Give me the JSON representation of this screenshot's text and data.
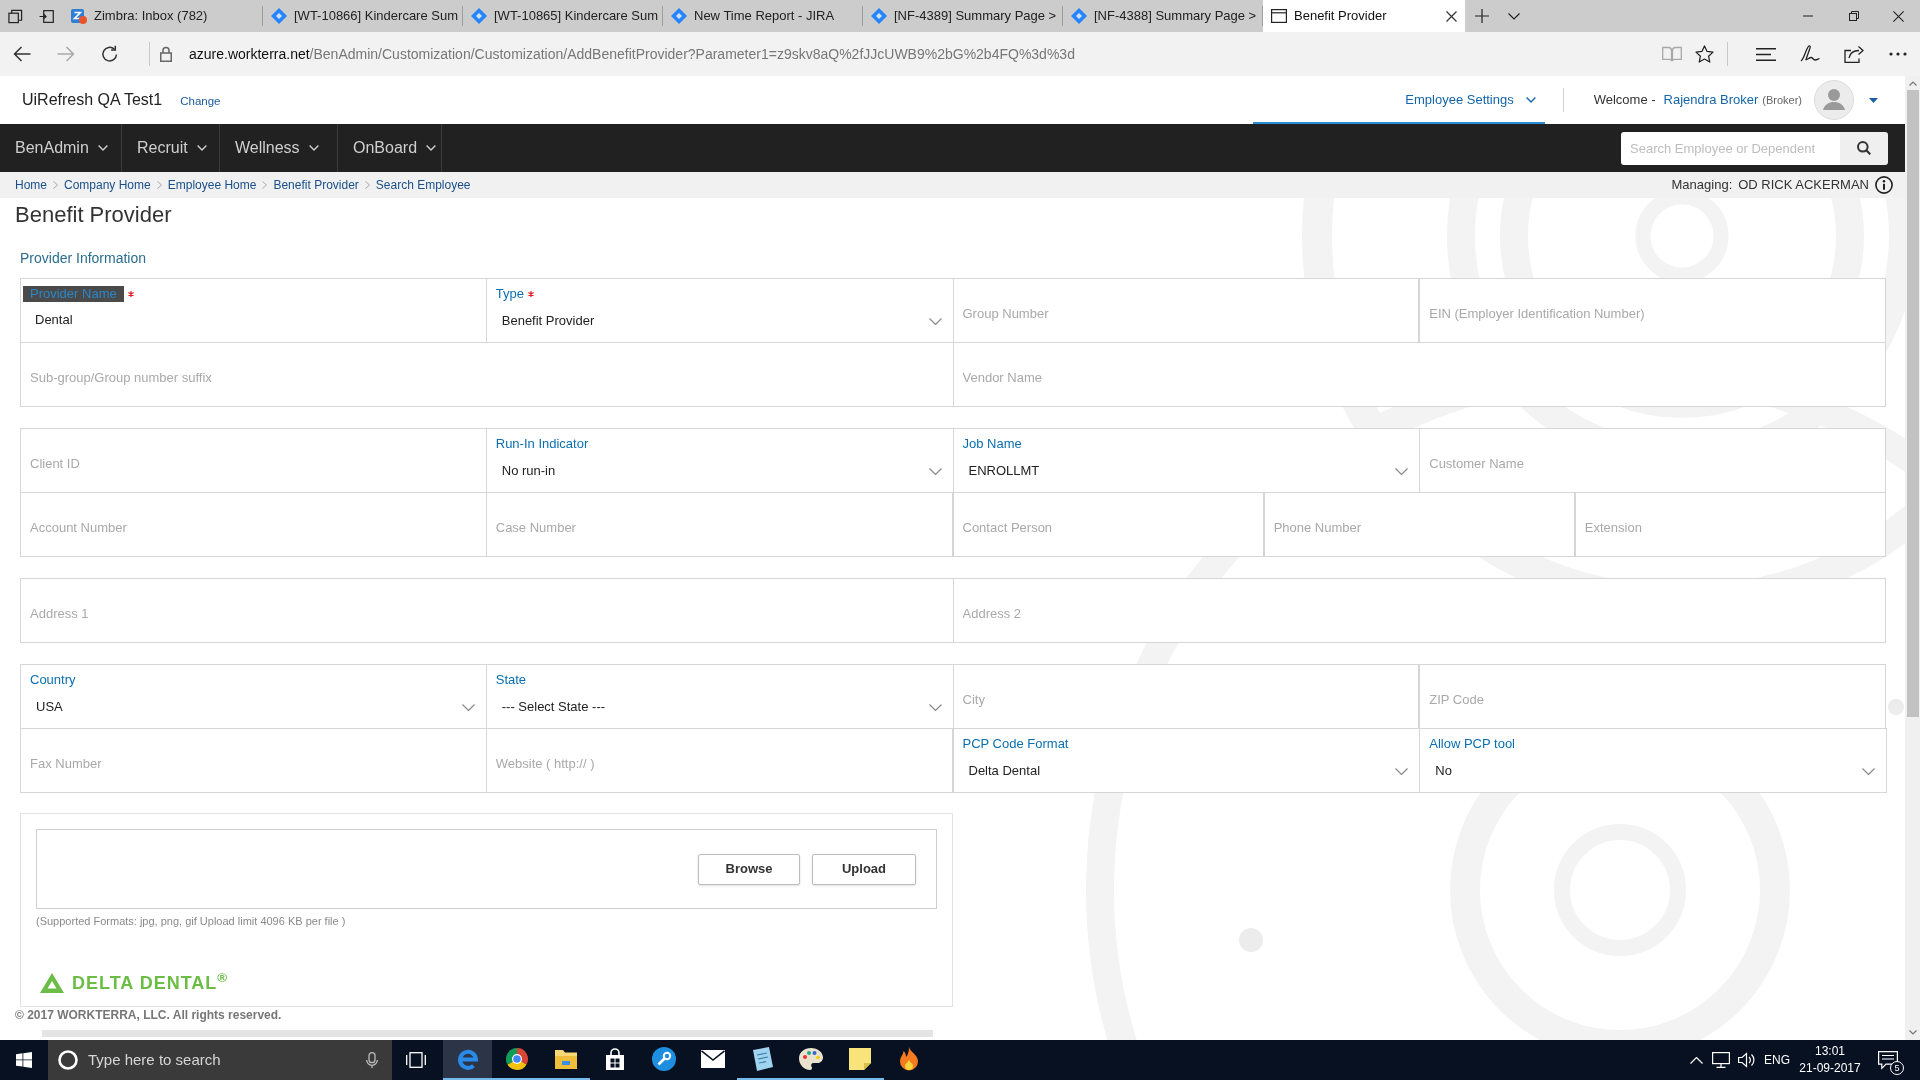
{
  "browser": {
    "tabs": [
      {
        "kind": "zimbra",
        "title": "Zimbra: Inbox (782)",
        "selected": false
      },
      {
        "kind": "jira",
        "title": "[WT-10866] Kindercare Sum",
        "selected": false
      },
      {
        "kind": "jira",
        "title": "[WT-10865] Kindercare Sum",
        "selected": false
      },
      {
        "kind": "jira",
        "title": "New Time Report - JIRA",
        "selected": false
      },
      {
        "kind": "jira",
        "title": "[NF-4389] Summary Page >",
        "selected": false
      },
      {
        "kind": "jira",
        "title": "[NF-4388] Summary Page >",
        "selected": false
      },
      {
        "kind": "page",
        "title": "Benefit Provider",
        "selected": true
      }
    ],
    "address": {
      "host": "azure.workterra.net",
      "path": "/BenAdmin/Customization/Customization/AddBenefitProvider?Parameter1=z9skv8aQ%2fJJcUWB9%2bG%2b4FQ%3d%3d"
    }
  },
  "header": {
    "company": "UiRefresh QA Test1",
    "change": "Change",
    "settings": "Employee Settings",
    "welcome": "Welcome -",
    "user": "Rajendra Broker",
    "role": "(Broker)"
  },
  "nav": {
    "menus": [
      {
        "label": "BenAdmin"
      },
      {
        "label": "Recruit"
      },
      {
        "label": "Wellness"
      },
      {
        "label": "OnBoard"
      }
    ],
    "search": {
      "placeholder": "Search Employee or Dependent"
    }
  },
  "breadcrumbs": [
    {
      "label": "Home"
    },
    {
      "label": "Company Home"
    },
    {
      "label": "Employee Home"
    },
    {
      "label": "Benefit Provider"
    },
    {
      "label": "Search Employee"
    }
  ],
  "managing": {
    "label": "Managing:",
    "name": "OD RICK ACKERMAN"
  },
  "title": "Benefit Provider",
  "section": "Provider Information",
  "groups": [
    {
      "rows": [
        {
          "fields": [
            {
              "kind": "text",
              "label": "Provider Name",
              "required": true,
              "highlighted": true,
              "value": "Dental"
            },
            {
              "kind": "select",
              "label": "Type",
              "required": true,
              "highlighted": false,
              "value": "Benefit Provider"
            },
            {
              "kind": "text",
              "placeholder": "Group Number",
              "required": false,
              "highlighted": false
            },
            {
              "kind": "text",
              "placeholder": "EIN (Employer Identification Number)",
              "required": false,
              "highlighted": false
            }
          ]
        },
        {
          "fields": [
            {
              "kind": "text",
              "placeholder": "Sub-group/Group number suffix",
              "required": false,
              "highlighted": false
            },
            {
              "kind": "text",
              "placeholder": "Vendor Name",
              "required": false,
              "highlighted": false
            }
          ]
        }
      ]
    },
    {
      "rows": [
        {
          "fields": [
            {
              "kind": "text",
              "placeholder": "Client ID",
              "required": false,
              "highlighted": false
            },
            {
              "kind": "select",
              "label": "Run-In Indicator",
              "required": false,
              "highlighted": false,
              "value": "No run-in"
            },
            {
              "kind": "select",
              "label": "Job Name",
              "required": false,
              "highlighted": false,
              "value": "ENROLLMT"
            },
            {
              "kind": "text",
              "placeholder": "Customer Name",
              "required": false,
              "highlighted": false
            }
          ]
        },
        {
          "fields": [
            {
              "kind": "text",
              "placeholder": "Account Number",
              "required": false,
              "highlighted": false
            },
            {
              "kind": "text",
              "placeholder": "Case Number",
              "required": false,
              "highlighted": false
            },
            {
              "kind": "text",
              "placeholder": "Contact Person",
              "required": false,
              "highlighted": false
            },
            {
              "kind": "text",
              "placeholder": "Phone Number",
              "required": false,
              "highlighted": false
            },
            {
              "kind": "text",
              "placeholder": "Extension",
              "required": false,
              "highlighted": false
            }
          ]
        }
      ]
    },
    {
      "rows": [
        {
          "fields": [
            {
              "kind": "text",
              "placeholder": "Address 1",
              "required": false,
              "highlighted": false
            },
            {
              "kind": "text",
              "placeholder": "Address 2",
              "required": false,
              "highlighted": false
            }
          ]
        }
      ]
    },
    {
      "rows": [
        {
          "fields": [
            {
              "kind": "select",
              "label": "Country",
              "required": false,
              "highlighted": false,
              "value": "USA"
            },
            {
              "kind": "select",
              "label": "State",
              "required": false,
              "highlighted": false,
              "value": "--- Select State ---"
            },
            {
              "kind": "text",
              "placeholder": "City",
              "required": false,
              "highlighted": false
            },
            {
              "kind": "text",
              "placeholder": "ZIP Code",
              "required": false,
              "highlighted": false
            }
          ]
        },
        {
          "fields": [
            {
              "kind": "text",
              "placeholder": "Fax Number",
              "required": false,
              "highlighted": false
            },
            {
              "kind": "text",
              "placeholder": "Website ( http:// )",
              "required": false,
              "highlighted": false
            },
            {
              "kind": "select",
              "label": "PCP Code Format",
              "required": false,
              "highlighted": false,
              "value": "Delta Dental"
            },
            {
              "kind": "select",
              "label": "Allow PCP tool",
              "required": false,
              "highlighted": false,
              "value": "No"
            }
          ]
        }
      ]
    }
  ],
  "upload": {
    "browse": "Browse",
    "upload": "Upload",
    "note": "(Supported Formats: jpg, png, gif Upload limit 4096 KB per file )",
    "logo": "DELTA DENTAL$^{®}$"
  },
  "footer": "© 2017 WORKTERRA, LLC. All rights reserved.",
  "taskbar": {
    "search": {
      "placeholder": "Type here to search"
    },
    "apps": [
      {
        "kind": "browser",
        "selected": true,
        "open": true
      },
      {
        "kind": "circle",
        "selected": false,
        "open": true
      },
      {
        "kind": "folder",
        "selected": false,
        "open": true
      },
      {
        "kind": "store",
        "selected": false,
        "open": false
      },
      {
        "kind": "wrench",
        "selected": false,
        "open": false
      },
      {
        "kind": "mail",
        "selected": false,
        "open": false
      },
      {
        "kind": "notepad",
        "selected": false,
        "open": true
      },
      {
        "kind": "palette",
        "selected": false,
        "open": true
      },
      {
        "kind": "sticky",
        "selected": false,
        "open": true
      },
      {
        "kind": "flame",
        "selected": false,
        "open": false
      }
    ],
    "tray": {
      "language": "ENG",
      "time": "13:01",
      "date": "21-09-2017",
      "notifications": "5"
    }
  }
}
